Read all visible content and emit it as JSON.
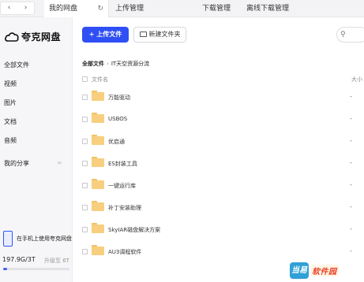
{
  "nav": {
    "back": "‹",
    "forward": "›"
  },
  "tabs": [
    {
      "label": "我的网盘",
      "active": true
    },
    {
      "label": "上传管理"
    },
    {
      "label": "下载管理"
    },
    {
      "label": "离线下载管理"
    }
  ],
  "sidebar": {
    "logo_text": "夸克网盘",
    "items": [
      {
        "label": "全部文件"
      },
      {
        "label": "视频"
      },
      {
        "label": "图片"
      },
      {
        "label": "文档"
      },
      {
        "label": "音频"
      },
      {
        "label": "我的分享"
      }
    ],
    "promo_text": "在手机上使用夸克网盘",
    "storage_text": "197.9G/3T",
    "upgrade_text": "升级至 6T",
    "storage_fraction": 0.064
  },
  "toolbar": {
    "upload_label": "+ 上传文件",
    "new_folder_label": "新建文件夹",
    "search_icon": "search-icon"
  },
  "breadcrumb": {
    "root": "全部文件",
    "current": "IT天空资源分流"
  },
  "list": {
    "header_name": "文件名",
    "header_size": "大小",
    "rows": [
      {
        "name": "万能驱动",
        "size": "-"
      },
      {
        "name": "USBOS",
        "size": "-"
      },
      {
        "name": "优启通",
        "size": "-"
      },
      {
        "name": "ES封装工具",
        "size": "-"
      },
      {
        "name": "一键运行库",
        "size": "-"
      },
      {
        "name": "补丁安装助理",
        "size": "-"
      },
      {
        "name": "SkyIAR磁盘解决方案",
        "size": "-"
      },
      {
        "name": "AU3调程软件",
        "size": "-"
      }
    ]
  },
  "watermark": {
    "badge": "当易",
    "text": "软件园"
  }
}
